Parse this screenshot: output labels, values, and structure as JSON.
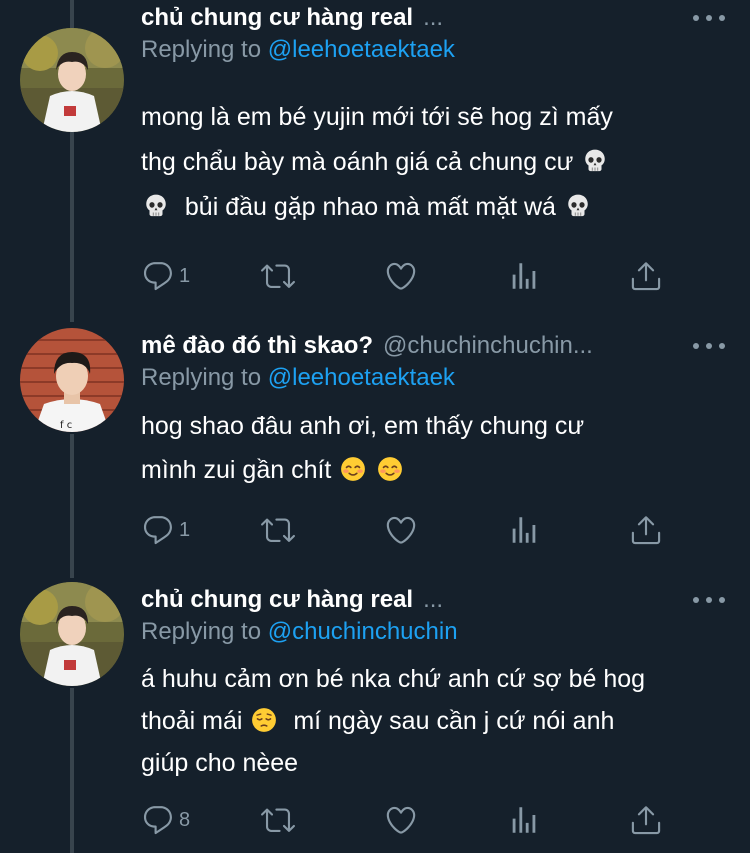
{
  "colors": {
    "background": "#15202b",
    "text_primary": "#ffffff",
    "text_secondary": "#8899a6",
    "link": "#1da1f2",
    "thread_line": "#38444d"
  },
  "tweets": [
    {
      "name": "chủ chung cư hàng real",
      "handle": "...",
      "replying_prefix": "Replying to",
      "replying_to": "@leehoetaektaek",
      "lines": [
        "mong là em bé yujin mới tới sẽ hog zì mấy",
        "thg chẩu bày mà oánh giá cả chung cư",
        "bủi đầu gặp nhao mà mất mặt wá"
      ],
      "emojis": [
        "skull",
        "skull",
        "skull"
      ],
      "reply_count": "1",
      "retweet_count": "",
      "like_count": ""
    },
    {
      "name": "mê đào đó thì skao?",
      "handle": "@chuchinchuchin...",
      "replying_prefix": "Replying to",
      "replying_to": "@leehoetaektaek",
      "lines": [
        "hog shao đâu anh ơi, em thấy chung cư",
        "mình zui gần chít"
      ],
      "emojis": [
        "smiling-face-with-smiling-eyes",
        "smiling-face-with-smiling-eyes"
      ],
      "reply_count": "1",
      "retweet_count": "",
      "like_count": ""
    },
    {
      "name": "chủ chung cư hàng real",
      "handle": "...",
      "replying_prefix": "Replying to",
      "replying_to": "@chuchinchuchin",
      "lines": [
        "á huhu cảm ơn bé nka chứ anh cứ sợ bé hog",
        "thoải mái",
        "mí ngày sau cần j cứ nói anh",
        "giúp cho nèee"
      ],
      "emojis": [
        "pensive-face"
      ],
      "reply_count": "8",
      "retweet_count": "",
      "like_count": ""
    }
  ]
}
